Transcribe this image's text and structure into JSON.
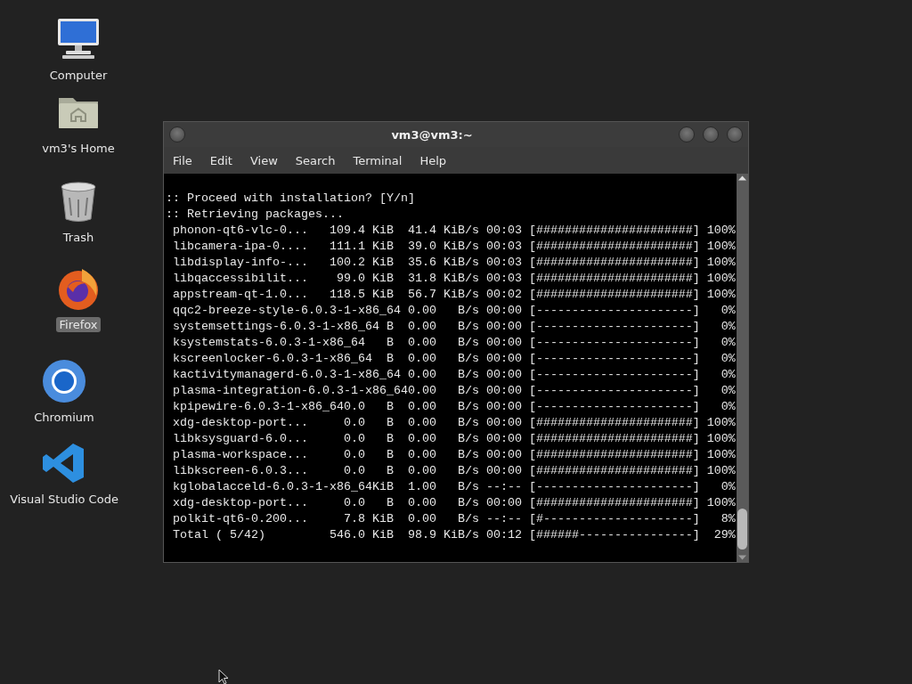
{
  "desktop_icons": [
    {
      "kind": "computer",
      "label": "Computer",
      "selected": false
    },
    {
      "kind": "home",
      "label": "vm3's Home",
      "selected": false
    },
    {
      "kind": "trash",
      "label": "Trash",
      "selected": false
    },
    {
      "kind": "firefox",
      "label": "Firefox",
      "selected": true
    },
    {
      "kind": "chromium",
      "label": "Chromium",
      "selected": false
    },
    {
      "kind": "vscode",
      "label": "Visual Studio Code",
      "selected": false
    }
  ],
  "terminal_window": {
    "title": "vm3@vm3:~",
    "menu": [
      "File",
      "Edit",
      "View",
      "Search",
      "Terminal",
      "Help"
    ],
    "lines": [
      ":: Proceed with installation? [Y/n]",
      ":: Retrieving packages...",
      " phonon-qt6-vlc-0...   109.4 KiB  41.4 KiB/s 00:03 [######################] 100%",
      " libcamera-ipa-0....   111.1 KiB  39.0 KiB/s 00:03 [######################] 100%",
      " libdisplay-info-...   100.2 KiB  35.6 KiB/s 00:03 [######################] 100%",
      " libqaccessibilit...    99.0 KiB  31.8 KiB/s 00:03 [######################] 100%",
      " appstream-qt-1.0...   118.5 KiB  56.7 KiB/s 00:02 [######################] 100%",
      " qqc2-breeze-style-6.0.3-1-x86_64 0.00   B/s 00:00 [----------------------]   0%",
      " systemsettings-6.0.3-1-x86_64 B  0.00   B/s 00:00 [----------------------]   0%",
      " ksystemstats-6.0.3-1-x86_64   B  0.00   B/s 00:00 [----------------------]   0%",
      " kscreenlocker-6.0.3-1-x86_64  B  0.00   B/s 00:00 [----------------------]   0%",
      " kactivitymanagerd-6.0.3-1-x86_64 0.00   B/s 00:00 [----------------------]   0%",
      " plasma-integration-6.0.3-1-x86_640.00   B/s 00:00 [----------------------]   0%",
      " kpipewire-6.0.3-1-x86_640.0   B  0.00   B/s 00:00 [----------------------]   0%",
      " xdg-desktop-port...     0.0   B  0.00   B/s 00:00 [######################] 100%",
      " libksysguard-6.0...     0.0   B  0.00   B/s 00:00 [######################] 100%",
      " plasma-workspace...     0.0   B  0.00   B/s 00:00 [######################] 100%",
      " libkscreen-6.0.3...     0.0   B  0.00   B/s 00:00 [######################] 100%",
      " kglobalacceld-6.0.3-1-x86_64KiB  1.00   B/s --:-- [----------------------]   0%",
      " xdg-desktop-port...     0.0   B  0.00   B/s 00:00 [######################] 100%",
      " polkit-qt6-0.200...     7.8 KiB  0.00   B/s --:-- [#---------------------]   8%",
      " Total ( 5/42)         546.0 KiB  98.9 KiB/s 00:12 [######----------------]  29%"
    ]
  }
}
